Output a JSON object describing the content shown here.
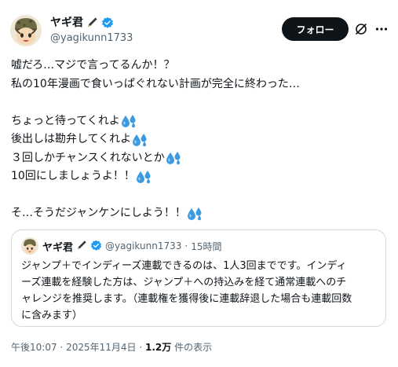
{
  "author": {
    "display_name": "ヤギ君",
    "handle": "@yagikunn1733",
    "badge_icon": "pen-icon",
    "verified_icon": "verified-badge-icon",
    "verified_color": "#1d9bf0"
  },
  "actions": {
    "follow_label": "フォロー",
    "grok_icon": "grok-icon",
    "more_icon": "more-icon"
  },
  "tweet": {
    "lines": [
      "嘘だろ…マジで言ってるんか！？",
      "私の10年漫画で食いっぱぐれない計画が完全に終わった…",
      "",
      "ちょっと待ってくれよ",
      "後出しは勘弁してくれよ",
      "３回しかチャンスくれないとか",
      "10回にしましょうよ！！",
      "",
      "そ…そうだジャンケンにしよう！！"
    ],
    "emoji_icon": "sweat-droplets-icon",
    "emoji_color": "#3b9ae1"
  },
  "quote": {
    "display_name": "ヤギ君",
    "handle": "@yagikunn1733",
    "separator": "·",
    "time": "15時間",
    "lines": [
      "ジャンプ＋でインディーズ連載できるのは、1人3回までです。インディ",
      "ーズ連載を経験した方は、ジャンプ＋への持込みを経て通常連載へのチ",
      "ャレンジを推奨します。（連載権を獲得後に連載辞退した場合も連載回数",
      "に含みます）"
    ]
  },
  "meta": {
    "time": "午後10:07",
    "separator": "·",
    "date": "2025年11月4日",
    "views": "1.2万",
    "views_label": "件の表示"
  }
}
